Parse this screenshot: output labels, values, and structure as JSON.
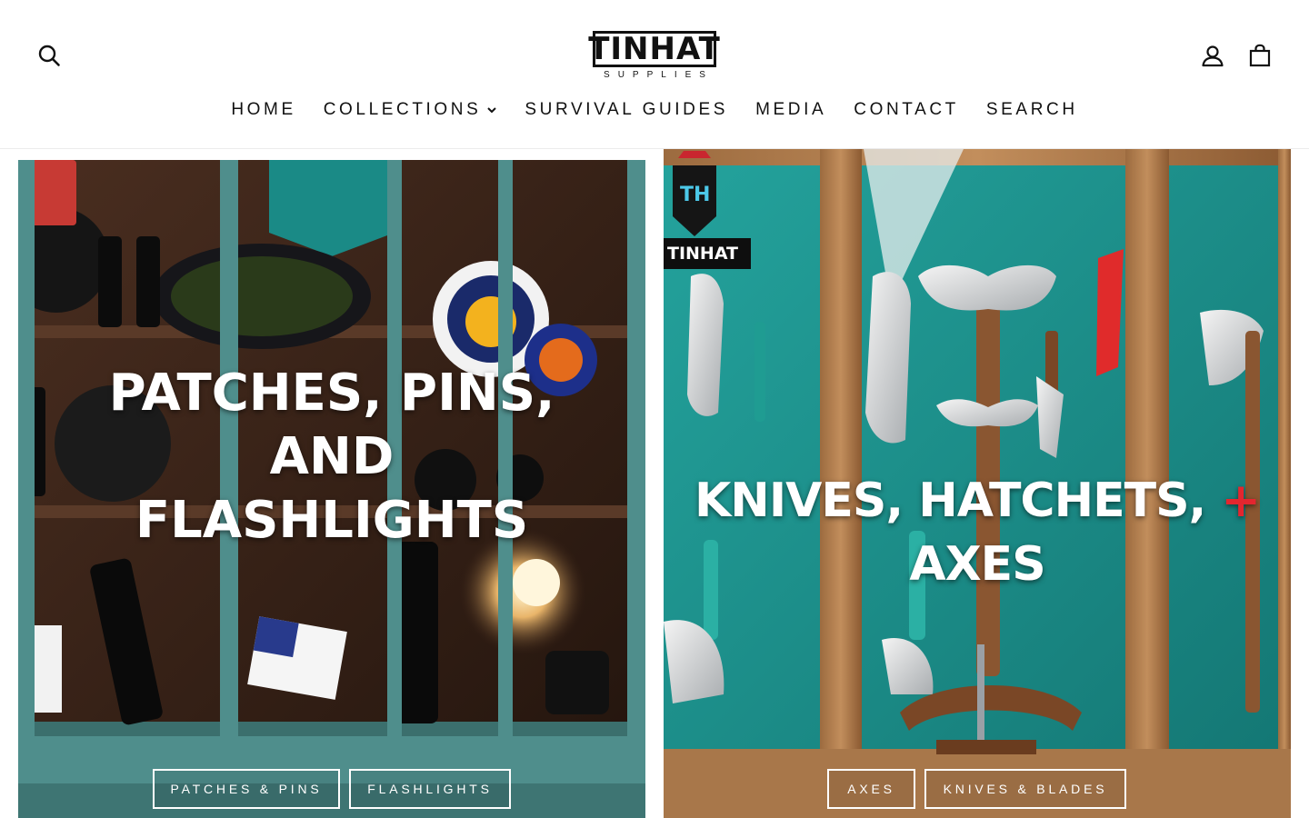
{
  "brand": {
    "logo_text": "TINHAT",
    "logo_subtext": "SUPPLIES"
  },
  "header": {
    "icons": {
      "search": "search-icon",
      "account": "account-icon",
      "cart": "cart-icon"
    }
  },
  "nav": {
    "items": [
      {
        "label": "HOME"
      },
      {
        "label": "COLLECTIONS",
        "has_dropdown": true
      },
      {
        "label": "SURVIVAL GUIDES"
      },
      {
        "label": "MEDIA"
      },
      {
        "label": "CONTACT"
      },
      {
        "label": "SEARCH"
      }
    ]
  },
  "collections": [
    {
      "title_lines": [
        "PATCHES, PINS,",
        "AND",
        "FLASHLIGHTS"
      ],
      "buttons": [
        "PATCHES & PINS",
        "FLASHLIGHTS"
      ]
    },
    {
      "title_part1": "KNIVES, HATCHETS, ",
      "title_plus": "+",
      "title_part2": " AXES",
      "badge_text": "TH",
      "badge_word": "TINHAT",
      "buttons": [
        "AXES",
        "KNIVES & BLADES"
      ]
    }
  ],
  "colors": {
    "accent_teal": "#1e8c8a",
    "cabinet_teal": "#4f8e8c",
    "plus_red": "#e3262f",
    "text_dark": "#111111"
  }
}
